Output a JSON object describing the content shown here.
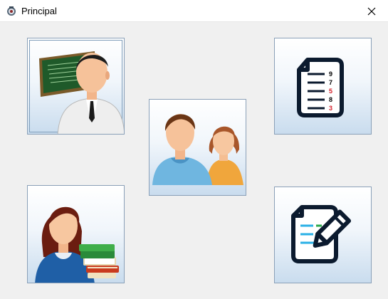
{
  "window": {
    "title": "Principal",
    "app_icon": "coat-of-arms-icon",
    "close_icon": "close-icon"
  },
  "tiles": [
    {
      "name": "teacher-button",
      "icon": "teacher-at-blackboard-icon"
    },
    {
      "name": "students-button",
      "icon": "students-icon"
    },
    {
      "name": "grades-report-button",
      "icon": "grades-document-icon"
    },
    {
      "name": "librarian-button",
      "icon": "woman-with-books-icon"
    },
    {
      "name": "edit-grades-button",
      "icon": "edit-document-icon"
    }
  ],
  "grades_document": {
    "numbers": [
      "9",
      "7",
      "5",
      "8",
      "3"
    ],
    "colors": [
      "#000000",
      "#000000",
      "#d4202a",
      "#000000",
      "#d4202a"
    ]
  },
  "colors": {
    "document_stroke": "#0b1a2e",
    "tile_border": "#8aa0b8",
    "tile_gradient_bottom": "#c9dcee"
  }
}
